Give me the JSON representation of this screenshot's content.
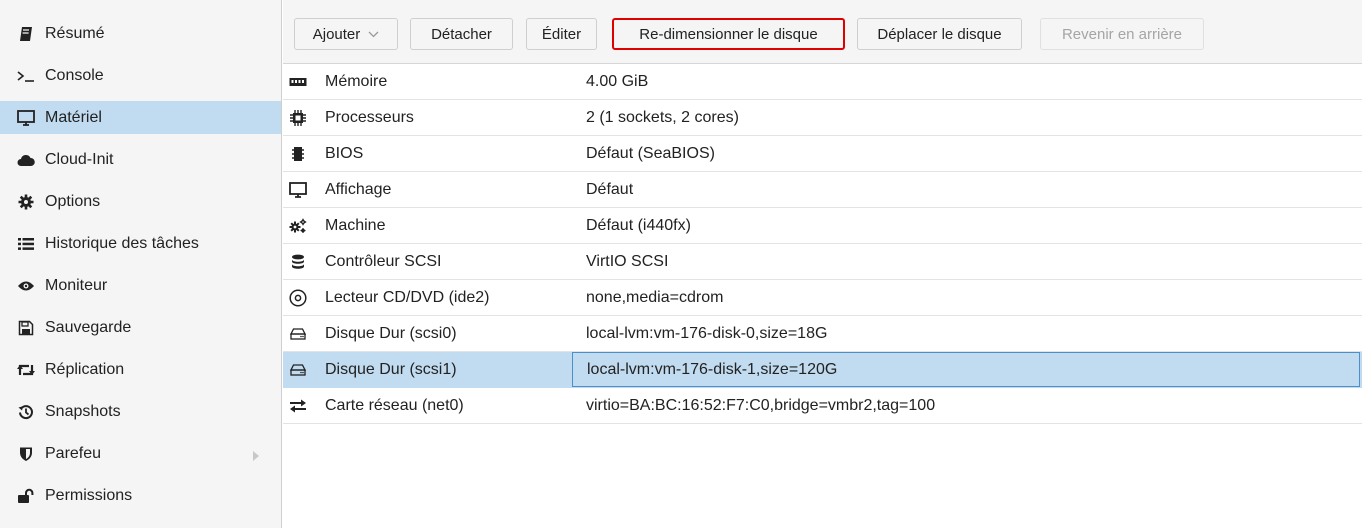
{
  "sidebar": {
    "items": [
      {
        "label": "Résumé",
        "icon": "book-icon"
      },
      {
        "label": "Console",
        "icon": "terminal-icon"
      },
      {
        "label": "Matériel",
        "icon": "desktop-icon",
        "selected": true
      },
      {
        "label": "Cloud-Init",
        "icon": "cloud-icon"
      },
      {
        "label": "Options",
        "icon": "gear-icon"
      },
      {
        "label": "Historique des tâches",
        "icon": "list-icon"
      },
      {
        "label": "Moniteur",
        "icon": "eye-icon"
      },
      {
        "label": "Sauvegarde",
        "icon": "floppy-icon"
      },
      {
        "label": "Réplication",
        "icon": "retweet-icon"
      },
      {
        "label": "Snapshots",
        "icon": "history-icon"
      },
      {
        "label": "Parefeu",
        "icon": "shield-icon",
        "has_submenu": true
      },
      {
        "label": "Permissions",
        "icon": "unlock-icon"
      }
    ]
  },
  "toolbar": {
    "add_label": "Ajouter",
    "detach_label": "Détacher",
    "edit_label": "Éditer",
    "resize_label": "Re-dimensionner le disque",
    "move_label": "Déplacer le disque",
    "revert_label": "Revenir en arrière"
  },
  "hardware": {
    "rows": [
      {
        "key": "Mémoire",
        "value": "4.00 GiB",
        "icon": "memory-icon"
      },
      {
        "key": "Processeurs",
        "value": "2 (1 sockets, 2 cores)",
        "icon": "cpu-icon"
      },
      {
        "key": "BIOS",
        "value": "Défaut (SeaBIOS)",
        "icon": "microchip-icon"
      },
      {
        "key": "Affichage",
        "value": "Défaut",
        "icon": "desktop-icon"
      },
      {
        "key": "Machine",
        "value": "Défaut (i440fx)",
        "icon": "cogs-icon"
      },
      {
        "key": "Contrôleur SCSI",
        "value": "VirtIO SCSI",
        "icon": "database-icon"
      },
      {
        "key": "Lecteur CD/DVD (ide2)",
        "value": "none,media=cdrom",
        "icon": "cdrom-icon"
      },
      {
        "key": "Disque Dur (scsi0)",
        "value": "local-lvm:vm-176-disk-0,size=18G",
        "icon": "hdd-icon"
      },
      {
        "key": "Disque Dur (scsi1)",
        "value": "local-lvm:vm-176-disk-1,size=120G",
        "icon": "hdd-icon",
        "selected": true
      },
      {
        "key": "Carte réseau (net0)",
        "value": "virtio=BA:BC:16:52:F7:C0,bridge=vmbr2,tag=100",
        "icon": "exchange-icon"
      }
    ]
  },
  "colors": {
    "selection": "#c1dcf0",
    "highlight_border": "#e00000",
    "sidebar_bg": "#f5f5f5"
  }
}
